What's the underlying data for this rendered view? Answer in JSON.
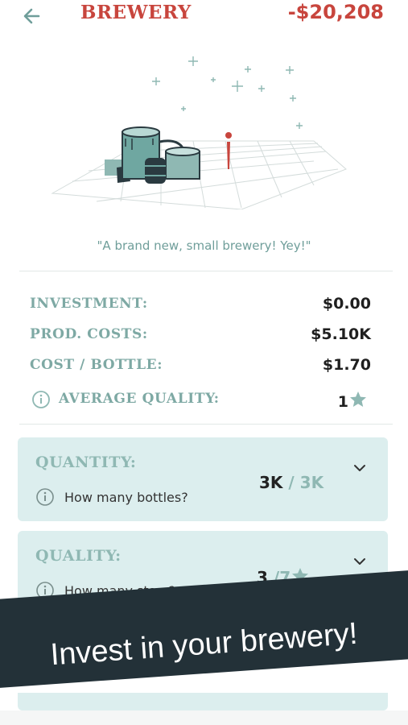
{
  "header": {
    "title": "BREWERY",
    "balance": "-$20,208",
    "back_icon": "arrow-left-icon",
    "accent_color": "#c8453d"
  },
  "illustration": {
    "description_icon": "brewery-illustration"
  },
  "tagline": "\"A brand new, small brewery! Yey!\"",
  "stats": {
    "investment_label": "INVESTMENT:",
    "investment_value": "$0.00",
    "prod_costs_label": "PROD. COSTS:",
    "prod_costs_value": "$5.10K",
    "cost_bottle_label": "COST / BOTTLE:",
    "cost_bottle_value": "$1.70",
    "avg_quality_label": "AVERAGE QUALITY:",
    "avg_quality_value": "1"
  },
  "quantity_card": {
    "title": "QUANTITY:",
    "subtitle": "How many bottles?",
    "current": "3K",
    "separator": " / ",
    "max": "3K"
  },
  "quality_card": {
    "title": "QUALITY:",
    "subtitle": "How many stars?",
    "current": "3",
    "separator": " /",
    "max": "7"
  },
  "banner": {
    "text": "Invest in your brewery!"
  }
}
